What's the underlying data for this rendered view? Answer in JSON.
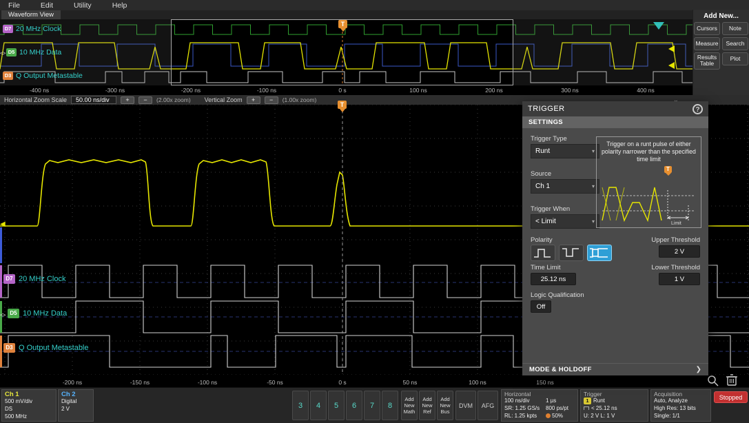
{
  "menu": {
    "items": [
      "File",
      "Edit",
      "Utility",
      "Help"
    ]
  },
  "tabs": {
    "waveform_view": "Waveform View"
  },
  "ui": {
    "dropdown_arrow": "▾",
    "collapse_chevron": "⌄",
    "expand_chevron": "❯",
    "t_marker": "T",
    "selector_glyph": "<>",
    "ch1_marker": "◀"
  },
  "colors": {
    "ch1_yellow": "#e6e600",
    "cyan_label": "#35d0cb",
    "selected_blue": "#2f9fd6",
    "stopped_red": "#c23030",
    "badge_d7": "#b565c8",
    "badge_d5": "#49a949",
    "badge_d3": "#e0823c",
    "trigger_orange": "#e89030"
  },
  "overview": {
    "channels": [
      {
        "badge": "D7",
        "label": "20 MHz Clock"
      },
      {
        "badge": "D5",
        "label": "10 MHz Data"
      },
      {
        "badge": "D3",
        "label": "Q Output Metastable"
      }
    ],
    "time_labels": [
      "-400 ns",
      "-300 ns",
      "-200 ns",
      "-100 ns",
      "0 s",
      "100 ns",
      "200 ns",
      "300 ns",
      "400 ns"
    ]
  },
  "zoom_bar": {
    "horizontal_label": "Horizontal Zoom Scale",
    "horizontal_scale": "50.00 ns/div",
    "plus": "+",
    "minus": "−",
    "horizontal_zoom": "(2.00x zoom)",
    "vertical_label": "Vertical Zoom",
    "vertical_zoom": "(1.00x zoom)"
  },
  "add_new": {
    "title": "Add New...",
    "buttons": [
      "Cursors",
      "Note",
      "Measure",
      "Search",
      "Results Table",
      "Plot"
    ]
  },
  "main_view": {
    "channels": [
      {
        "badge": "D7",
        "label": "20 MHz Clock"
      },
      {
        "badge": "D5",
        "label": "10 MHz Data"
      },
      {
        "badge": "D3",
        "label": "Q Output Metastable"
      }
    ],
    "time_labels": [
      "-200 ns",
      "-150 ns",
      "-100 ns",
      "-50 ns",
      "0 s",
      "50 ns",
      "100 ns",
      "150 ns"
    ]
  },
  "trigger_panel": {
    "title": "TRIGGER",
    "help": "?",
    "settings": "SETTINGS",
    "trigger_type_label": "Trigger Type",
    "trigger_type": "Runt",
    "source_label": "Source",
    "source": "Ch 1",
    "when_label": "Trigger When",
    "when": "< Limit",
    "description": "Trigger on a runt pulse of either polarity narrower than the specified time limit",
    "diagram_limit": "Limit",
    "polarity_label": "Polarity",
    "upper_label": "Upper Threshold",
    "upper": "2 V",
    "time_limit_label": "Time Limit",
    "time_limit": "25.12 ns",
    "lower_label": "Lower Threshold",
    "lower": "1 V",
    "logic_label": "Logic Qualification",
    "logic": "Off",
    "mode_holdoff": "MODE & HOLDOFF"
  },
  "bottom_bar": {
    "ch1": {
      "name": "Ch 1",
      "scale": "500 mV/div",
      "coupling": "DS",
      "bandwidth": "500 MHz"
    },
    "ch2": {
      "name": "Ch 2",
      "mode": "Digital",
      "threshold": "2 V"
    },
    "channel_buttons": [
      "3",
      "4",
      "5",
      "6",
      "7",
      "8"
    ],
    "add_math": [
      "Add",
      "New",
      "Math"
    ],
    "add_ref": [
      "Add",
      "New",
      "Ref"
    ],
    "add_bus": [
      "Add",
      "New",
      "Bus"
    ],
    "dvm": "DVM",
    "afg": "AFG",
    "horizontal": {
      "title": "Horizontal",
      "scale": "100 ns/div",
      "length": "1 µs",
      "sr": "SR: 1.25 GS/s",
      "resolution": "800 ps/pt",
      "rl": "RL: 1.25 kpts",
      "position": "50%"
    },
    "trigger": {
      "title": "Trigger",
      "source_badge": "1",
      "type": "Runt",
      "limit": "< 25.12 ns",
      "levels": "U: 2 V  L: 1 V"
    },
    "acquisition": {
      "title": "Acquisition",
      "mode": "Auto,  Analyze",
      "detail": "High Res: 13 bits",
      "single": "Single: 1/1"
    },
    "stopped": "Stopped"
  }
}
